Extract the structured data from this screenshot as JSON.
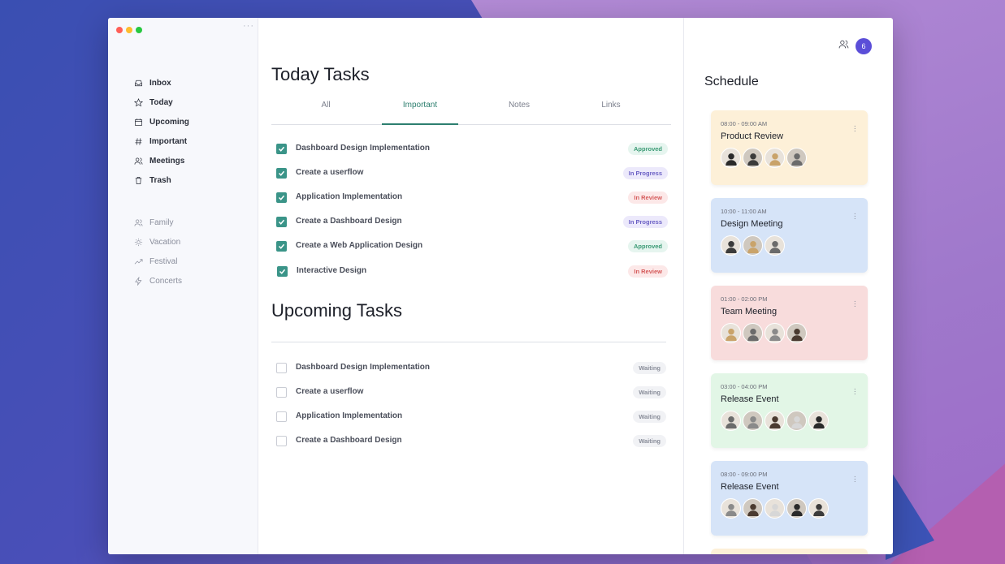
{
  "sidebar": {
    "primary": [
      {
        "label": "Inbox",
        "icon": "inbox-icon"
      },
      {
        "label": "Today",
        "icon": "star-icon"
      },
      {
        "label": "Upcoming",
        "icon": "calendar-icon"
      },
      {
        "label": "Important",
        "icon": "hash-icon"
      },
      {
        "label": "Meetings",
        "icon": "users-icon"
      },
      {
        "label": "Trash",
        "icon": "trash-icon"
      }
    ],
    "secondary": [
      {
        "label": "Family",
        "icon": "users-icon"
      },
      {
        "label": "Vacation",
        "icon": "sun-icon"
      },
      {
        "label": "Festival",
        "icon": "trending-icon"
      },
      {
        "label": "Concerts",
        "icon": "bolt-icon"
      }
    ]
  },
  "main": {
    "today_title": "Today Tasks",
    "tabs": [
      {
        "label": "All"
      },
      {
        "label": "Important"
      },
      {
        "label": "Notes"
      },
      {
        "label": "Links"
      }
    ],
    "active_tab": "Important",
    "today_tasks": [
      {
        "label": "Dashboard Design Implementation",
        "status": "Approved",
        "checked": true
      },
      {
        "label": "Create a userflow",
        "status": "In Progress",
        "checked": true
      },
      {
        "label": "Application Implementation",
        "status": "In Review",
        "checked": true
      },
      {
        "label": "Create a Dashboard Design",
        "status": "In Progress",
        "checked": true
      },
      {
        "label": "Create a Web Application Design",
        "status": "Approved",
        "checked": true
      },
      {
        "label": "Interactive Design",
        "status": "In Review",
        "checked": true
      }
    ],
    "upcoming_title": "Upcoming Tasks",
    "upcoming_tasks": [
      {
        "label": "Dashboard Design Implementation",
        "status": "Waiting",
        "checked": false
      },
      {
        "label": "Create a userflow",
        "status": "Waiting",
        "checked": false
      },
      {
        "label": "Application Implementation",
        "status": "Waiting",
        "checked": false
      },
      {
        "label": "Create a Dashboard Design",
        "status": "Waiting",
        "checked": false
      }
    ]
  },
  "schedule": {
    "title": "Schedule",
    "notification_count": "6",
    "events": [
      {
        "time": "08:00 - 09:00 AM",
        "title": "Product Review",
        "color": "#fdf0d8",
        "attendees": 4
      },
      {
        "time": "10:00 - 11:00 AM",
        "title": "Design Meeting",
        "color": "#d6e4f8",
        "attendees": 3
      },
      {
        "time": "01:00 - 02:00 PM",
        "title": "Team Meeting",
        "color": "#f8dcdc",
        "attendees": 4
      },
      {
        "time": "03:00 - 04:00 PM",
        "title": "Release Event",
        "color": "#e2f6e6",
        "attendees": 5
      },
      {
        "time": "08:00 - 09:00 PM",
        "title": "Release Event",
        "color": "#d6e4f8",
        "attendees": 5
      }
    ]
  },
  "colors": {
    "accent": "#2d7f6f",
    "check": "#3a9488",
    "notification": "#5b4ed8"
  }
}
